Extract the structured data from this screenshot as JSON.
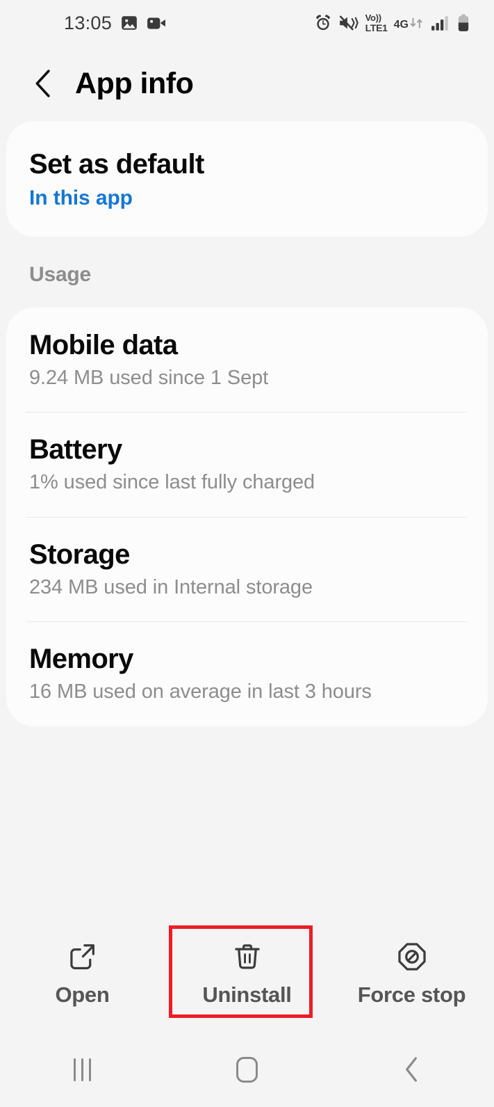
{
  "status_bar": {
    "time": "13:05",
    "left_icons": [
      "image-icon",
      "video-camera-icon"
    ],
    "right_icons": [
      "alarm-icon",
      "mute-vibrate-icon",
      "volte-icon",
      "mobile-data-icon",
      "signal-bars-icon",
      "battery-icon"
    ],
    "volte_line1": "Vo))",
    "volte_line2": "LTE1",
    "network_type": "4G"
  },
  "header": {
    "back_icon": "chevron-left-icon",
    "title": "App info"
  },
  "default_card": {
    "title": "Set as default",
    "subtitle": "In this app",
    "link_color": "#1577d2"
  },
  "usage": {
    "section_label": "Usage",
    "rows": [
      {
        "title": "Mobile data",
        "subtitle": "9.24 MB used since 1 Sept"
      },
      {
        "title": "Battery",
        "subtitle": "1% used since last fully charged"
      },
      {
        "title": "Storage",
        "subtitle": "234 MB used in Internal storage"
      },
      {
        "title": "Memory",
        "subtitle": "16 MB used on average in last 3 hours"
      }
    ]
  },
  "actions": {
    "buttons": [
      {
        "label": "Open",
        "icon": "open-external-icon"
      },
      {
        "label": "Uninstall",
        "icon": "trash-icon"
      },
      {
        "label": "Force stop",
        "icon": "octagon-block-icon"
      }
    ],
    "highlight_target": "Uninstall",
    "highlight_color": "#ee1c25"
  },
  "nav_bar": {
    "recents": "recents-icon",
    "home": "home-icon",
    "back": "back-icon"
  }
}
